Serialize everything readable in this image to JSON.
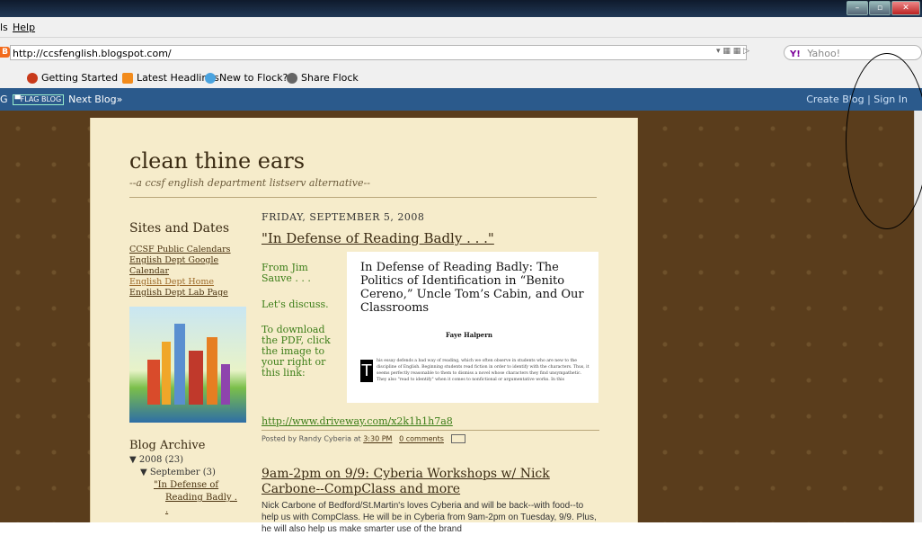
{
  "menu": {
    "partial": "ls",
    "help": "Help"
  },
  "navigation": {
    "url": "http://ccsfenglish.blogspot.com/",
    "search_placeholder": "Yahoo!",
    "search_engine_logo": "Y!"
  },
  "bookmarks": [
    {
      "label": "Getting Started",
      "icon": "flock-icon"
    },
    {
      "label": "Latest Headlines",
      "icon": "rss-icon"
    },
    {
      "label": "New to Flock?",
      "icon": "flock-bird-icon"
    },
    {
      "label": "Share Flock",
      "icon": "share-icon"
    }
  ],
  "blogger_bar": {
    "g": "G",
    "flag": "▀FLAG BLOG",
    "next": "Next Blog»",
    "create": "Create Blog",
    "sep": "|",
    "signin": "Sign In"
  },
  "blog": {
    "title": "clean thine ears",
    "description": "--a ccsf english department listserv alternative--"
  },
  "sidebar": {
    "heading": "Sites and Dates",
    "links": [
      "CCSF Public Calendars",
      "English Dept Google Calendar",
      "English Dept Home",
      "English Dept Lab Page"
    ],
    "archive_heading": "Blog Archive",
    "archive_year": "▼ 2008 (23)",
    "archive_month": "▼ September (3)",
    "archive_post1": "\"In Defense of",
    "archive_post2": "Reading Badly . ."
  },
  "post1": {
    "date": "FRIDAY, SEPTEMBER 5, 2008",
    "title": "\"In Defense of Reading Badly . . .\"",
    "from": "From Jim Sauve . . .",
    "discuss": "Let's discuss.",
    "download": "To download the PDF, click the image to your right or this link:",
    "link": "http://www.driveway.com/x2k1h1h7a8",
    "posted_by": "Posted by Randy Cyberia at",
    "time": "3:30 PM",
    "comments": "0 comments"
  },
  "paper": {
    "title": "In Defense of Reading Badly: The Politics of Identification in “Benito Cereno,” Uncle Tom’s Cabin, and Our Classrooms",
    "author": "Faye Halpern",
    "initial": "T",
    "text": "his essay defends a bad way of reading, which we often observe in students who are new to the discipline of English. Beginning students read fiction in order to identify with the characters. Thus, it seems perfectly reasonable to them to dismiss a novel whose characters they find unsympathetic. They also \"read to identify\" when it comes to nonfictional or argumentative works. In this"
  },
  "post2": {
    "title": "9am-2pm on 9/9: Cyberia Workshops w/ Nick Carbone--CompClass and more",
    "body": "Nick Carbone of Bedford/St.Martin's loves Cyberia and will be back--with food--to help us with CompClass. He will be in Cyberia from 9am-2pm on Tuesday, 9/9. Plus, he will also help us make smarter use of the brand"
  }
}
